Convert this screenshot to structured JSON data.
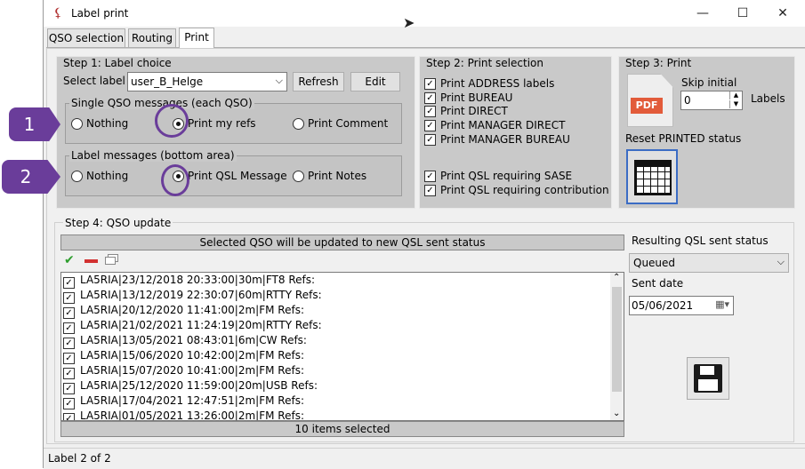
{
  "window": {
    "title": "Label print",
    "min": "—",
    "max": "☐",
    "close": "✕"
  },
  "tabs": [
    {
      "label": "QSO selection"
    },
    {
      "label": "Routing"
    },
    {
      "label": "Print"
    }
  ],
  "step1": {
    "title": "Step 1: Label choice",
    "select_label": "Select label",
    "label_value": "user_B_Helge",
    "refresh": "Refresh",
    "edit": "Edit",
    "single_group": "Single QSO messages (each QSO)",
    "single_options": [
      "Nothing",
      "Print my refs",
      "Print Comment"
    ],
    "single_selected": 1,
    "label_group": "Label messages (bottom area)",
    "label_options": [
      "Nothing",
      "Print QSL Message",
      "Print Notes"
    ],
    "label_selected": 1
  },
  "step2": {
    "title": "Step 2: Print selection",
    "checks": [
      "Print ADDRESS labels",
      "Print BUREAU",
      "Print DIRECT",
      "Print MANAGER DIRECT",
      "Print MANAGER BUREAU"
    ],
    "checks2": [
      "Print QSL requiring SASE",
      "Print QSL requiring contribution"
    ]
  },
  "step3": {
    "title": "Step 3: Print",
    "pdf_text": "PDF",
    "skip_initial": "Skip initial",
    "skip_value": "0",
    "labels": "Labels",
    "reset": "Reset PRINTED status"
  },
  "step4": {
    "title": "Step 4: QSO update",
    "banner": "Selected QSO will be updated to new QSL sent status",
    "rows": [
      "LA5RIA|23/12/2018 20:33:00|30m|FT8 Refs:",
      "LA5RIA|13/12/2019 22:30:07|60m|RTTY Refs:",
      "LA5RIA|20/12/2020 11:41:00|2m|FM Refs:",
      "LA5RIA|21/02/2021 11:24:19|20m|RTTY Refs:",
      "LA5RIA|13/05/2021 08:43:01|6m|CW Refs:",
      "LA5RIA|15/06/2020 10:42:00|2m|FM Refs:",
      "LA5RIA|15/07/2020 10:41:00|2m|FM Refs:",
      "LA5RIA|25/12/2020 11:59:00|20m|USB Refs:",
      "LA5RIA|17/04/2021 12:47:51|2m|FM Refs:",
      "LA5RIA|01/05/2021 13:26:00|2m|FM Refs:"
    ],
    "footer": "10 items selected",
    "result_label": "Resulting QSL sent status",
    "result_value": "Queued",
    "sent_date_label": "Sent date",
    "sent_date": "05/06/2021"
  },
  "statusbar": {
    "label": "Label",
    "current": "2",
    "of": "of",
    "total": "2"
  },
  "annotations": {
    "one": "1",
    "two": "2"
  },
  "colors": {
    "accent": "#6a3d9a",
    "pdf": "#e25b3a",
    "panel": "#c9c9c9"
  }
}
